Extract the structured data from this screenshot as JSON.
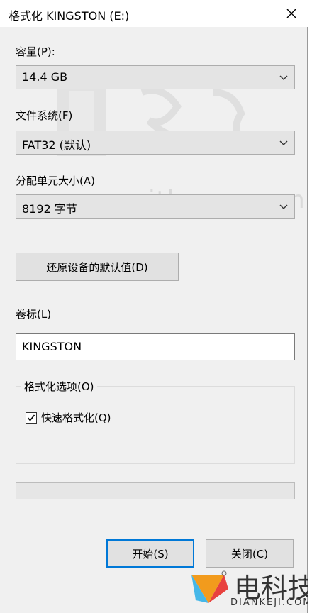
{
  "window": {
    "title": "格式化 KINGSTON (E:)"
  },
  "capacity": {
    "label": "容量(P):",
    "value": "14.4 GB"
  },
  "file_system": {
    "label": "文件系统(F)",
    "value": "FAT32 (默认)"
  },
  "allocation_unit": {
    "label": "分配单元大小(A)",
    "value": "8192 字节"
  },
  "restore_defaults_button": "还原设备的默认值(D)",
  "volume_label": {
    "label": "卷标(L)",
    "value": "KINGSTON"
  },
  "format_options": {
    "title": "格式化选项(O)",
    "quick_format_label": "快速格式化(Q)",
    "quick_format_checked": true
  },
  "progress": {
    "fraction": 0
  },
  "buttons": {
    "start": "开始(S)",
    "close": "关闭(C)"
  },
  "watermark": {
    "url": "www.ithome.com"
  },
  "brand": {
    "name_cn": "电科技",
    "name_en": "DIANKEJI.COM"
  },
  "colors": {
    "accent": "#0078d7",
    "background": "#f0f0f0"
  },
  "icons": {
    "close": "close-icon",
    "dropdown": "chevron-down-icon",
    "check": "checkmark-icon"
  }
}
